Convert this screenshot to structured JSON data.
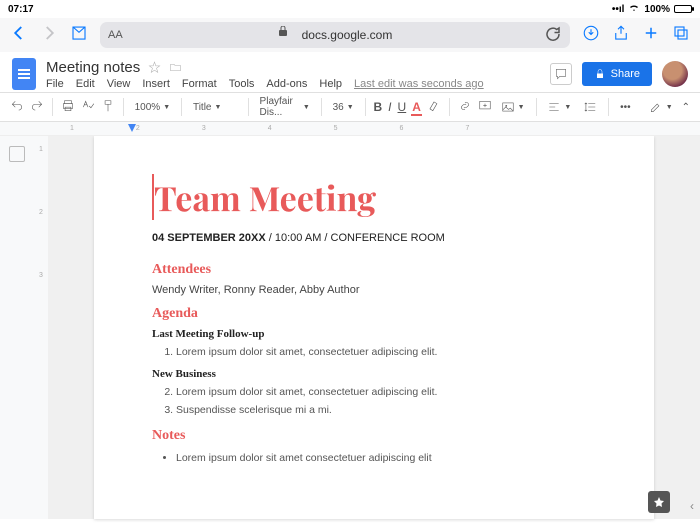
{
  "status": {
    "time": "07:17",
    "battery": "100%"
  },
  "browser": {
    "url": "docs.google.com",
    "aa": "AA"
  },
  "doc": {
    "title": "Meeting notes",
    "menus": [
      "File",
      "Edit",
      "View",
      "Insert",
      "Format",
      "Tools",
      "Add-ons",
      "Help"
    ],
    "last_edit": "Last edit was seconds ago",
    "share": "Share"
  },
  "toolbar": {
    "zoom": "100%",
    "style": "Title",
    "font": "Playfair Dis...",
    "size": "36",
    "B": "B",
    "I": "I",
    "U": "U",
    "A": "A"
  },
  "ruler_h": [
    "1",
    "2",
    "3",
    "4",
    "5",
    "6",
    "7"
  ],
  "ruler_v": [
    "1",
    "2",
    "3"
  ],
  "content": {
    "h1": "Team Meeting",
    "date_strong": "04 SEPTEMBER 20XX",
    "date_rest": " / 10:00 AM / CONFERENCE ROOM",
    "attendees_h": "Attendees",
    "attendees": "Wendy Writer, Ronny Reader, Abby Author",
    "agenda_h": "Agenda",
    "sub1": "Last Meeting Follow-up",
    "li1": "Lorem ipsum dolor sit amet, consectetuer adipiscing elit.",
    "sub2": "New Business",
    "li2": "Lorem ipsum dolor sit amet, consectetuer adipiscing elit.",
    "li3": "Suspendisse scelerisque mi a mi.",
    "notes_h": "Notes",
    "note1": "Lorem ipsum dolor sit amet consectetuer adipiscing elit"
  }
}
